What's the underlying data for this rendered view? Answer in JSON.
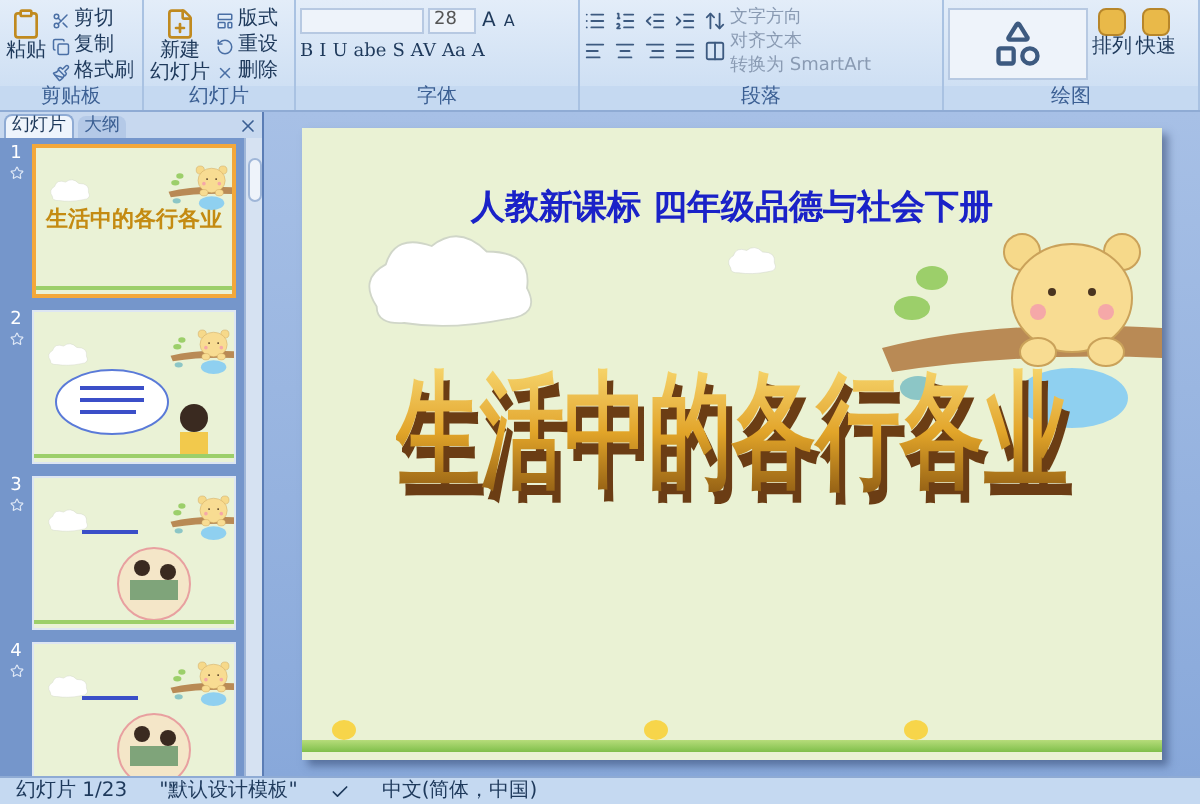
{
  "ribbon": {
    "groups": [
      {
        "label": "剪贴板",
        "kind": "clipboard",
        "big": {
          "lines": [
            "粘贴"
          ]
        },
        "small": [
          {
            "label": "剪切"
          },
          {
            "label": "复制"
          },
          {
            "label": "格式刷"
          }
        ]
      },
      {
        "label": "幻灯片",
        "kind": "slides",
        "big": {
          "lines": [
            "新建",
            "幻灯片"
          ]
        },
        "small": [
          {
            "label": "版式"
          },
          {
            "label": "重设"
          },
          {
            "label": "删除"
          }
        ]
      },
      {
        "label": "字体",
        "kind": "font",
        "font_size": "28",
        "size_buttons": [
          "A",
          "A"
        ],
        "format_buttons": [
          "B",
          "I",
          "U",
          "abe",
          "S",
          "AV",
          "Aa",
          "A"
        ]
      },
      {
        "label": "段落",
        "kind": "paragraph",
        "text_buttons": [
          {
            "label": "文字方向",
            "disabled": true
          },
          {
            "label": "对齐文本",
            "disabled": true
          },
          {
            "label": "转换为 SmartArt",
            "disabled": true
          }
        ]
      },
      {
        "label": "绘图",
        "kind": "drawing",
        "buttons": [
          "排列",
          "快速"
        ]
      }
    ]
  },
  "slide_panel": {
    "tabs": [
      {
        "label": "幻灯片",
        "selected": true
      },
      {
        "label": "大纲",
        "selected": false
      }
    ],
    "slides": [
      {
        "number": "1",
        "kind": "title",
        "selected": true,
        "title": "生活中的各行各业"
      },
      {
        "number": "2",
        "kind": "bubble",
        "selected": false
      },
      {
        "number": "3",
        "selected": false
      },
      {
        "number": "4",
        "selected": false
      }
    ]
  },
  "slide": {
    "subtitle": "人教新课标 四年级品德与社会下册",
    "title": "生活中的各行各业"
  },
  "status_bar": {
    "slide_count": "幻灯片 1/23",
    "theme": "\"默认设计模板\"",
    "language": "中文(简体，中国)"
  }
}
